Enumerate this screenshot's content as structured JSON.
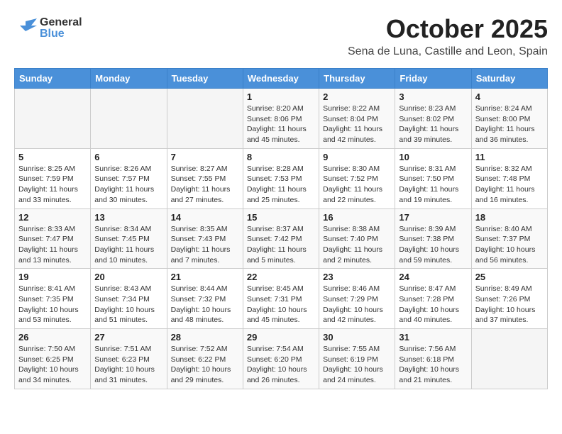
{
  "header": {
    "title": "October 2025",
    "location": "Sena de Luna, Castille and Leon, Spain",
    "logo_general": "General",
    "logo_blue": "Blue"
  },
  "weekdays": [
    "Sunday",
    "Monday",
    "Tuesday",
    "Wednesday",
    "Thursday",
    "Friday",
    "Saturday"
  ],
  "weeks": [
    {
      "days": [
        {
          "num": "",
          "info": ""
        },
        {
          "num": "",
          "info": ""
        },
        {
          "num": "",
          "info": ""
        },
        {
          "num": "1",
          "info": "Sunrise: 8:20 AM\nSunset: 8:06 PM\nDaylight: 11 hours\nand 45 minutes."
        },
        {
          "num": "2",
          "info": "Sunrise: 8:22 AM\nSunset: 8:04 PM\nDaylight: 11 hours\nand 42 minutes."
        },
        {
          "num": "3",
          "info": "Sunrise: 8:23 AM\nSunset: 8:02 PM\nDaylight: 11 hours\nand 39 minutes."
        },
        {
          "num": "4",
          "info": "Sunrise: 8:24 AM\nSunset: 8:00 PM\nDaylight: 11 hours\nand 36 minutes."
        }
      ]
    },
    {
      "days": [
        {
          "num": "5",
          "info": "Sunrise: 8:25 AM\nSunset: 7:59 PM\nDaylight: 11 hours\nand 33 minutes."
        },
        {
          "num": "6",
          "info": "Sunrise: 8:26 AM\nSunset: 7:57 PM\nDaylight: 11 hours\nand 30 minutes."
        },
        {
          "num": "7",
          "info": "Sunrise: 8:27 AM\nSunset: 7:55 PM\nDaylight: 11 hours\nand 27 minutes."
        },
        {
          "num": "8",
          "info": "Sunrise: 8:28 AM\nSunset: 7:53 PM\nDaylight: 11 hours\nand 25 minutes."
        },
        {
          "num": "9",
          "info": "Sunrise: 8:30 AM\nSunset: 7:52 PM\nDaylight: 11 hours\nand 22 minutes."
        },
        {
          "num": "10",
          "info": "Sunrise: 8:31 AM\nSunset: 7:50 PM\nDaylight: 11 hours\nand 19 minutes."
        },
        {
          "num": "11",
          "info": "Sunrise: 8:32 AM\nSunset: 7:48 PM\nDaylight: 11 hours\nand 16 minutes."
        }
      ]
    },
    {
      "days": [
        {
          "num": "12",
          "info": "Sunrise: 8:33 AM\nSunset: 7:47 PM\nDaylight: 11 hours\nand 13 minutes."
        },
        {
          "num": "13",
          "info": "Sunrise: 8:34 AM\nSunset: 7:45 PM\nDaylight: 11 hours\nand 10 minutes."
        },
        {
          "num": "14",
          "info": "Sunrise: 8:35 AM\nSunset: 7:43 PM\nDaylight: 11 hours\nand 7 minutes."
        },
        {
          "num": "15",
          "info": "Sunrise: 8:37 AM\nSunset: 7:42 PM\nDaylight: 11 hours\nand 5 minutes."
        },
        {
          "num": "16",
          "info": "Sunrise: 8:38 AM\nSunset: 7:40 PM\nDaylight: 11 hours\nand 2 minutes."
        },
        {
          "num": "17",
          "info": "Sunrise: 8:39 AM\nSunset: 7:38 PM\nDaylight: 10 hours\nand 59 minutes."
        },
        {
          "num": "18",
          "info": "Sunrise: 8:40 AM\nSunset: 7:37 PM\nDaylight: 10 hours\nand 56 minutes."
        }
      ]
    },
    {
      "days": [
        {
          "num": "19",
          "info": "Sunrise: 8:41 AM\nSunset: 7:35 PM\nDaylight: 10 hours\nand 53 minutes."
        },
        {
          "num": "20",
          "info": "Sunrise: 8:43 AM\nSunset: 7:34 PM\nDaylight: 10 hours\nand 51 minutes."
        },
        {
          "num": "21",
          "info": "Sunrise: 8:44 AM\nSunset: 7:32 PM\nDaylight: 10 hours\nand 48 minutes."
        },
        {
          "num": "22",
          "info": "Sunrise: 8:45 AM\nSunset: 7:31 PM\nDaylight: 10 hours\nand 45 minutes."
        },
        {
          "num": "23",
          "info": "Sunrise: 8:46 AM\nSunset: 7:29 PM\nDaylight: 10 hours\nand 42 minutes."
        },
        {
          "num": "24",
          "info": "Sunrise: 8:47 AM\nSunset: 7:28 PM\nDaylight: 10 hours\nand 40 minutes."
        },
        {
          "num": "25",
          "info": "Sunrise: 8:49 AM\nSunset: 7:26 PM\nDaylight: 10 hours\nand 37 minutes."
        }
      ]
    },
    {
      "days": [
        {
          "num": "26",
          "info": "Sunrise: 7:50 AM\nSunset: 6:25 PM\nDaylight: 10 hours\nand 34 minutes."
        },
        {
          "num": "27",
          "info": "Sunrise: 7:51 AM\nSunset: 6:23 PM\nDaylight: 10 hours\nand 31 minutes."
        },
        {
          "num": "28",
          "info": "Sunrise: 7:52 AM\nSunset: 6:22 PM\nDaylight: 10 hours\nand 29 minutes."
        },
        {
          "num": "29",
          "info": "Sunrise: 7:54 AM\nSunset: 6:20 PM\nDaylight: 10 hours\nand 26 minutes."
        },
        {
          "num": "30",
          "info": "Sunrise: 7:55 AM\nSunset: 6:19 PM\nDaylight: 10 hours\nand 24 minutes."
        },
        {
          "num": "31",
          "info": "Sunrise: 7:56 AM\nSunset: 6:18 PM\nDaylight: 10 hours\nand 21 minutes."
        },
        {
          "num": "",
          "info": ""
        }
      ]
    }
  ]
}
